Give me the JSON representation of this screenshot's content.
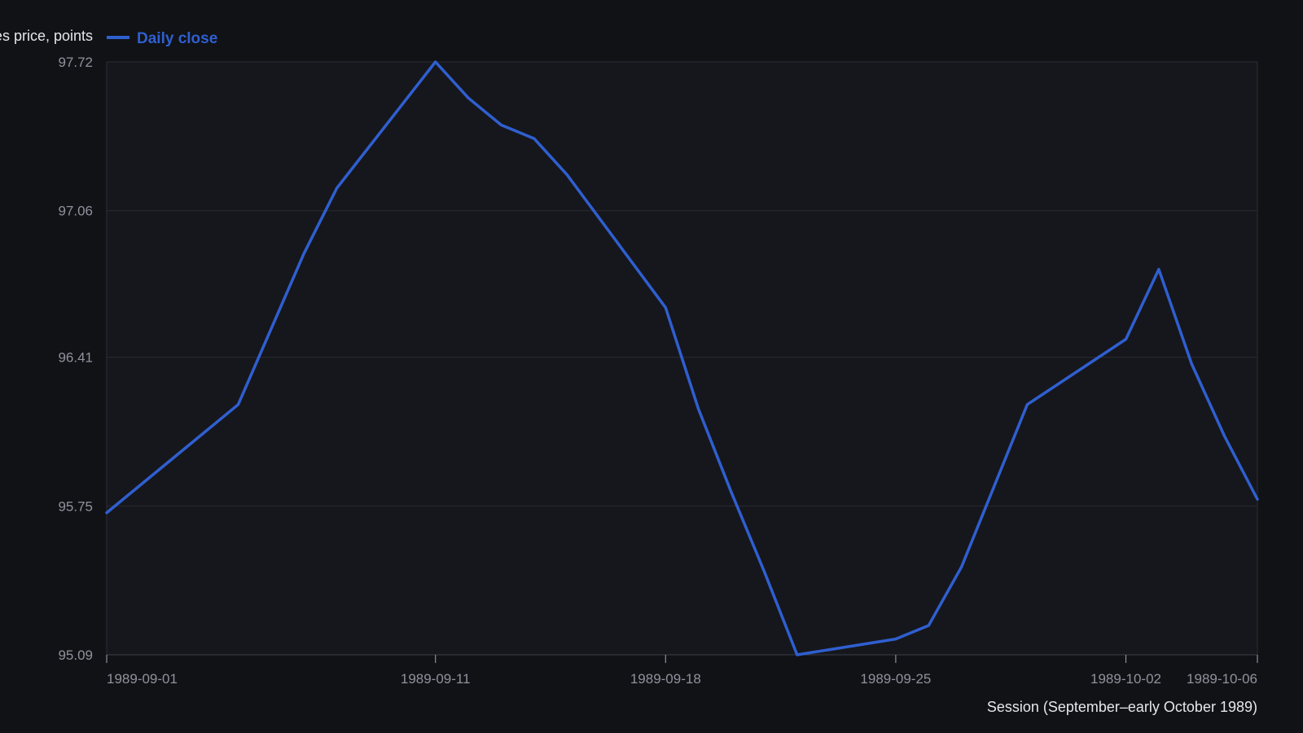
{
  "colors": {
    "background": "#111216",
    "plot_background": "#16171c",
    "series": "#2f5fd0"
  },
  "chart_data": {
    "type": "line",
    "title": "",
    "xlabel": "Session (September–early October 1989)",
    "ylabel": "Futures price, points",
    "ylim": [
      95.09,
      97.72
    ],
    "yticks": [
      95.09,
      95.75,
      96.41,
      97.06,
      97.72
    ],
    "xticks": [
      "1989-09-01",
      "1989-09-11",
      "1989-09-18",
      "1989-09-25",
      "1989-10-02",
      "1989-10-06"
    ],
    "grid": true,
    "legend_position": "top-left",
    "series": [
      {
        "name": "Daily close",
        "color": "#2f5fd0",
        "x": [
          "1989-09-01",
          "1989-09-05",
          "1989-09-07",
          "1989-09-08",
          "1989-09-11",
          "1989-09-12",
          "1989-09-13",
          "1989-09-14",
          "1989-09-15",
          "1989-09-18",
          "1989-09-19",
          "1989-09-20",
          "1989-09-21",
          "1989-09-22",
          "1989-09-25",
          "1989-09-26",
          "1989-09-27",
          "1989-09-29",
          "1989-10-02",
          "1989-10-03",
          "1989-10-04",
          "1989-10-05",
          "1989-10-06"
        ],
        "values": [
          95.72,
          96.2,
          96.87,
          97.16,
          97.72,
          97.56,
          97.44,
          97.38,
          97.22,
          96.63,
          96.18,
          95.81,
          95.46,
          95.09,
          95.16,
          95.22,
          95.48,
          96.2,
          96.49,
          96.8,
          96.38,
          96.06,
          95.78
        ]
      }
    ]
  }
}
